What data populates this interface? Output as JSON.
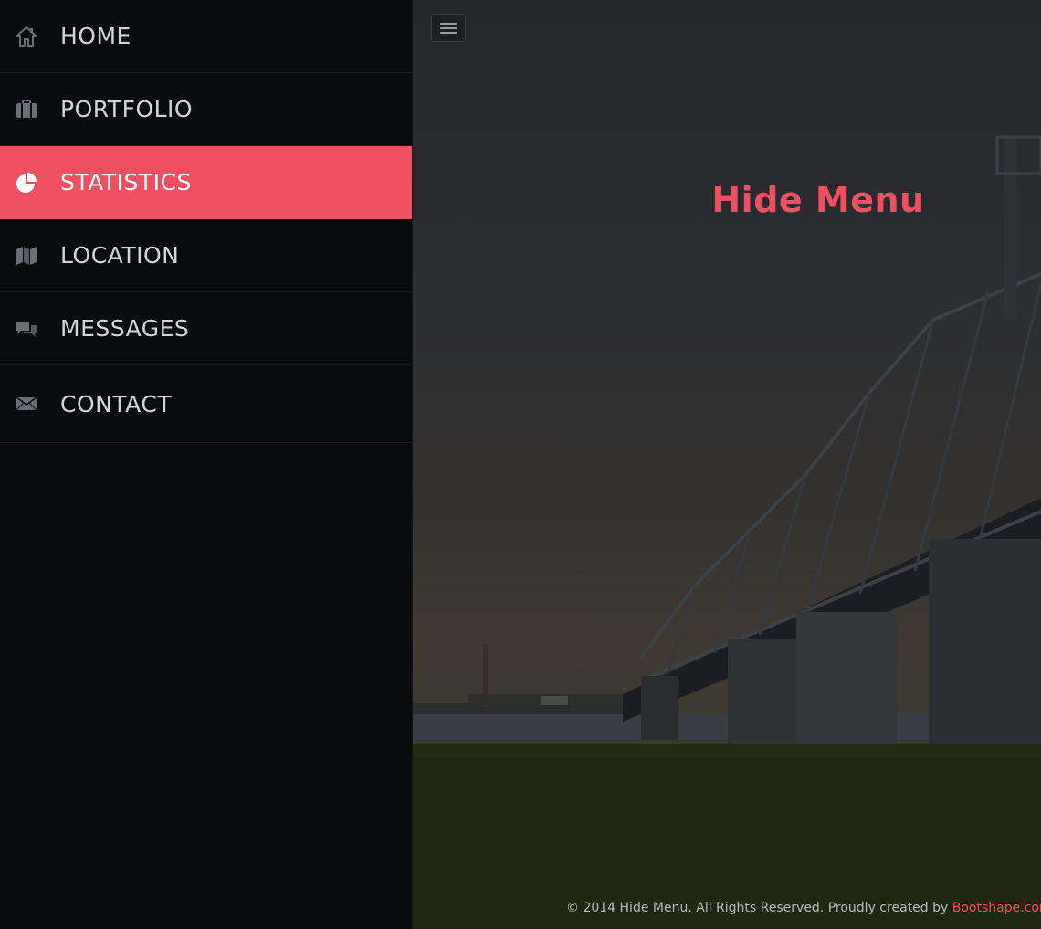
{
  "sidebar": {
    "items": [
      {
        "label": "HOME",
        "icon": "home-icon"
      },
      {
        "label": "PORTFOLIO",
        "icon": "briefcase-icon"
      },
      {
        "label": "STATISTICS",
        "icon": "pie-chart-icon",
        "active": true
      },
      {
        "label": "LOCATION",
        "icon": "map-icon"
      },
      {
        "label": "MESSAGES",
        "icon": "chat-bubbles-icon"
      },
      {
        "label": "CONTACT",
        "icon": "envelope-icon"
      }
    ]
  },
  "main": {
    "title": "Hide Menu",
    "menu_toggle_icon": "hamburger-icon"
  },
  "footer": {
    "text": "© 2014 Hide Menu. All Rights Reserved. Proudly created by ",
    "link": "Bootshape.com"
  },
  "colors": {
    "accent": "#ef5061",
    "sidebar_bg": "#0a0b0f",
    "menu_text": "#d3d5da"
  }
}
